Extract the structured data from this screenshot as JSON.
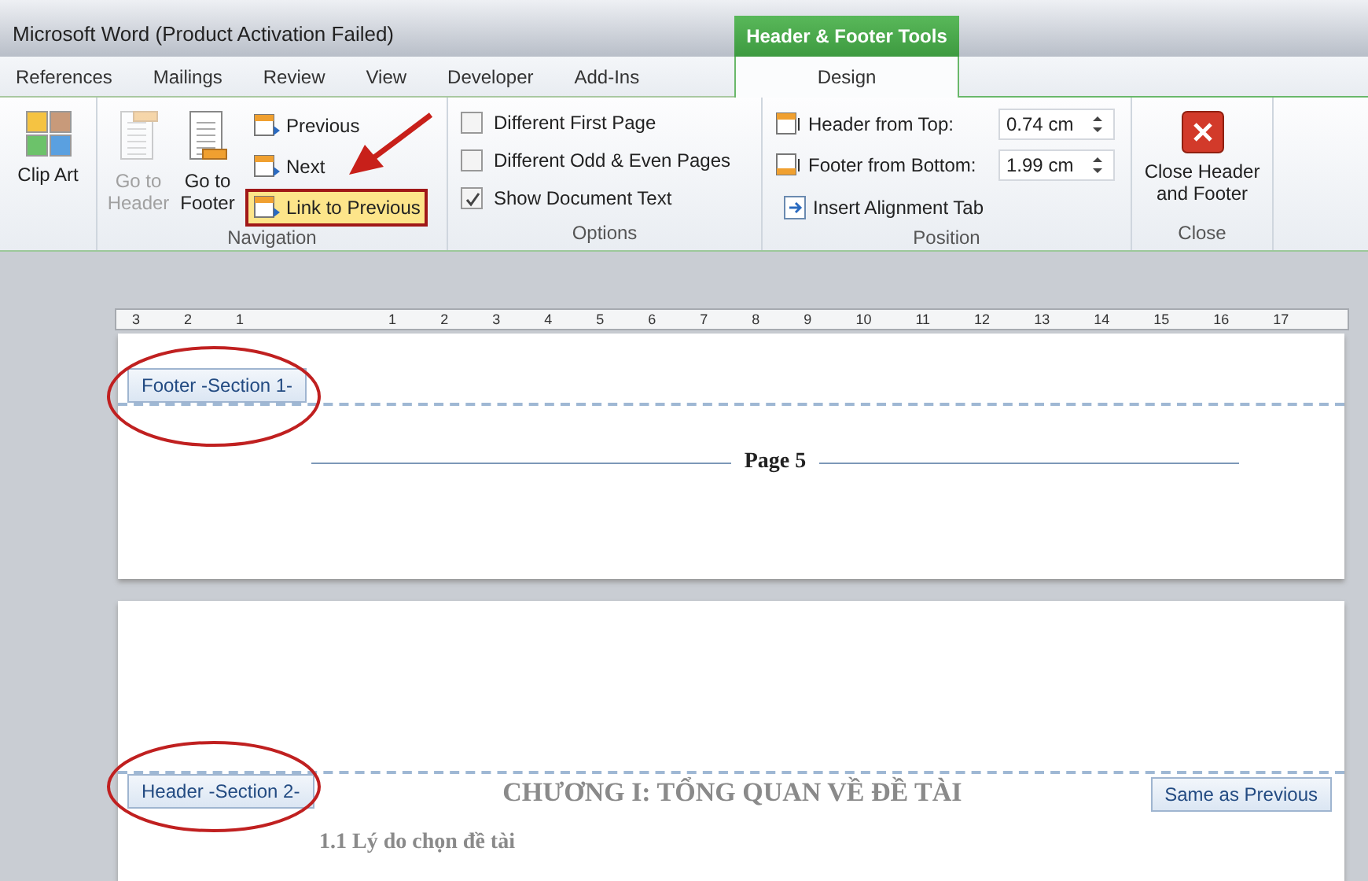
{
  "window": {
    "title": "Microsoft Word (Product Activation Failed)"
  },
  "tabs": [
    {
      "label": "References",
      "selected": false
    },
    {
      "label": "Mailings",
      "selected": false
    },
    {
      "label": "Review",
      "selected": false
    },
    {
      "label": "View",
      "selected": false
    },
    {
      "label": "Developer",
      "selected": false
    },
    {
      "label": "Add-Ins",
      "selected": false
    }
  ],
  "contextual_tab": {
    "group": "Header & Footer Tools",
    "tab": {
      "label": "Design",
      "selected": true
    }
  },
  "ribbon": {
    "clip_art": {
      "label": "Clip Art"
    },
    "navigation": {
      "title": "Navigation",
      "buttons": [
        {
          "label": "Go to Header",
          "disabled": true
        },
        {
          "label": "Go to Footer",
          "disabled": false
        }
      ],
      "items": [
        {
          "label": "Previous",
          "selected": false
        },
        {
          "label": "Next",
          "selected": false
        },
        {
          "label": "Link to Previous",
          "selected": true
        }
      ]
    },
    "options": {
      "title": "Options",
      "checkboxes": [
        {
          "label": "Different First Page",
          "checked": false
        },
        {
          "label": "Different Odd & Even Pages",
          "checked": false
        },
        {
          "label": "Show Document Text",
          "checked": true
        }
      ]
    },
    "position": {
      "title": "Position",
      "fields": [
        {
          "label": "Header from Top:",
          "value": "0.74 cm"
        },
        {
          "label": "Footer from Bottom:",
          "value": "1.99 cm"
        }
      ],
      "insert": "Insert Alignment Tab"
    },
    "close": {
      "title": "Close",
      "button": "Close Header and Footer"
    }
  },
  "ruler": {
    "labels": [
      "3",
      "2",
      "1",
      "1",
      "2",
      "3",
      "4",
      "5",
      "6",
      "7",
      "8",
      "9",
      "10",
      "11",
      "12",
      "13",
      "14",
      "15",
      "16",
      "17"
    ]
  },
  "pages": [
    {
      "footer_tag": "Footer -Section 1-",
      "footer_text": "Page 5"
    },
    {
      "header_tag": "Header -Section 2-",
      "heading": "CHƯƠNG I: TỔNG QUAN VỀ ĐỀ TÀI",
      "same_as_previous": "Same as Previous",
      "subheading": "1.1 Lý do chọn đề tài"
    }
  ]
}
